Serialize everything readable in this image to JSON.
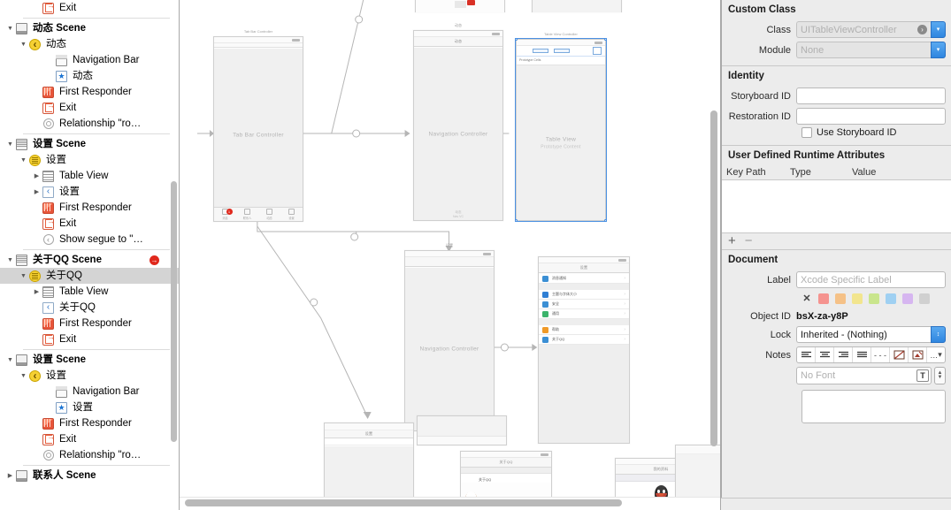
{
  "outline": {
    "rows": [
      {
        "indent": 3,
        "tri": "",
        "icon": "exit-icon",
        "label": "Exit",
        "sep_after": true
      },
      {
        "indent": 1,
        "tri": "down",
        "icon": "scene-icon",
        "label": "动态 Scene",
        "bold": true
      },
      {
        "indent": 2,
        "tri": "down",
        "icon": "nav-controller-icon",
        "label": "动态"
      },
      {
        "indent": 4,
        "tri": "",
        "icon": "navigation-bar-icon",
        "label": "Navigation Bar"
      },
      {
        "indent": 4,
        "tri": "",
        "icon": "bar-item-icon",
        "label": "动态"
      },
      {
        "indent": 3,
        "tri": "",
        "icon": "first-responder-icon",
        "label": "First Responder"
      },
      {
        "indent": 3,
        "tri": "",
        "icon": "exit-icon",
        "label": "Exit"
      },
      {
        "indent": 3,
        "tri": "",
        "icon": "relationship-icon",
        "label": "Relationship \"ro…",
        "sep_after": true
      },
      {
        "indent": 1,
        "tri": "down",
        "icon": "scene-table-icon",
        "label": "设置 Scene",
        "bold": true
      },
      {
        "indent": 2,
        "tri": "down",
        "icon": "table-controller-icon",
        "label": "设置"
      },
      {
        "indent": 3,
        "tri": "right",
        "icon": "table-view-icon",
        "label": "Table View"
      },
      {
        "indent": 3,
        "tri": "right",
        "icon": "nav-item-icon",
        "label": "设置"
      },
      {
        "indent": 3,
        "tri": "",
        "icon": "first-responder-icon",
        "label": "First Responder"
      },
      {
        "indent": 3,
        "tri": "",
        "icon": "exit-icon",
        "label": "Exit"
      },
      {
        "indent": 3,
        "tri": "",
        "icon": "segue-icon",
        "label": "Show segue to \"…",
        "sep_after": true
      },
      {
        "indent": 1,
        "tri": "down",
        "icon": "scene-table-icon",
        "label": "关于QQ Scene",
        "bold": true,
        "badge": "error"
      },
      {
        "indent": 2,
        "tri": "down",
        "icon": "table-controller-icon",
        "label": "关于QQ",
        "selected": true
      },
      {
        "indent": 3,
        "tri": "right",
        "icon": "table-view-icon",
        "label": "Table View"
      },
      {
        "indent": 3,
        "tri": "",
        "icon": "nav-item-icon",
        "label": "关于QQ"
      },
      {
        "indent": 3,
        "tri": "",
        "icon": "first-responder-icon",
        "label": "First Responder"
      },
      {
        "indent": 3,
        "tri": "",
        "icon": "exit-icon",
        "label": "Exit",
        "sep_after": true
      },
      {
        "indent": 1,
        "tri": "down",
        "icon": "scene-icon",
        "label": "设置 Scene",
        "bold": true
      },
      {
        "indent": 2,
        "tri": "down",
        "icon": "nav-controller-icon",
        "label": "设置"
      },
      {
        "indent": 4,
        "tri": "",
        "icon": "navigation-bar-icon",
        "label": "Navigation Bar"
      },
      {
        "indent": 4,
        "tri": "",
        "icon": "bar-item-icon",
        "label": "设置"
      },
      {
        "indent": 3,
        "tri": "",
        "icon": "first-responder-icon",
        "label": "First Responder"
      },
      {
        "indent": 3,
        "tri": "",
        "icon": "exit-icon",
        "label": "Exit"
      },
      {
        "indent": 3,
        "tri": "",
        "icon": "relationship-icon",
        "label": "Relationship \"ro…",
        "sep_after": true
      },
      {
        "indent": 1,
        "tri": "right",
        "icon": "scene-icon",
        "label": "联系人 Scene",
        "bold": true
      }
    ]
  },
  "canvas": {
    "scenes": [
      {
        "name": "tab-bar-controller",
        "title": "Tab Bar Controller",
        "placeholder": "Tab Bar Controller",
        "sub": ""
      },
      {
        "name": "navigation-controller-top",
        "title": "动态",
        "placeholder": "Navigation Controller",
        "sub": ""
      },
      {
        "name": "table-view-controller",
        "title": "Table View Controller",
        "placeholder": "Table View",
        "sub": "Prototype Content"
      },
      {
        "name": "navigation-controller-mid",
        "title": "设置",
        "placeholder": "Navigation Controller",
        "sub": ""
      },
      {
        "name": "settings-table-view",
        "title": "设置",
        "navtitle": "设置"
      },
      {
        "name": "about-qq-scene",
        "title": "关于QQ",
        "navtitle": "关于QQ"
      },
      {
        "name": "profile-scene",
        "title": "我",
        "navtitle": "我的资料"
      }
    ],
    "settings_rows": [
      {
        "label": "消息通知",
        "color": "#3b8fd4"
      },
      {
        "label": "主题与字体大小",
        "color": "#2f7fd4"
      },
      {
        "label": "安全",
        "color": "#3b8fd4"
      },
      {
        "label": "通用",
        "color": "#3bb36b"
      },
      {
        "label": "帮助",
        "color": "#f09a28"
      },
      {
        "label": "关于QQ",
        "color": "#3b8fd4"
      }
    ]
  },
  "inspector": {
    "custom_class": {
      "header": "Custom Class",
      "class_label": "Class",
      "class_value": "UITableViewController",
      "module_label": "Module",
      "module_value": "None"
    },
    "identity": {
      "header": "Identity",
      "storyboard_id_label": "Storyboard ID",
      "storyboard_id_value": "",
      "restoration_id_label": "Restoration ID",
      "restoration_id_value": "",
      "use_storyboard_id_label": "Use Storyboard ID"
    },
    "udra": {
      "header": "User Defined Runtime Attributes",
      "col_keypath": "Key Path",
      "col_type": "Type",
      "col_value": "Value",
      "add": "+",
      "remove": "−"
    },
    "document": {
      "header": "Document",
      "label_label": "Label",
      "label_placeholder": "Xcode Specific Label",
      "label_value": "",
      "swatch_clear": "✕",
      "swatches": [
        "#f5938f",
        "#f5c187",
        "#f2e58e",
        "#c9e58c",
        "#9fd0f2",
        "#d6b6f0",
        "#d0d0d0"
      ],
      "object_id_label": "Object ID",
      "object_id_value": "bsX-za-y8P",
      "lock_label": "Lock",
      "lock_value": "Inherited - (Nothing)",
      "notes_label": "Notes",
      "notes_more": "…",
      "font_placeholder": "No Font",
      "font_button": "T",
      "notes_value": ""
    }
  }
}
